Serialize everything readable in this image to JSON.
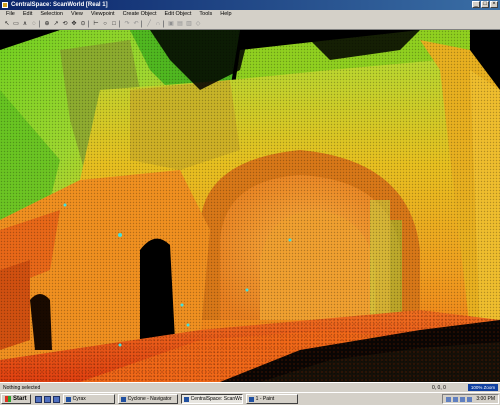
{
  "window": {
    "title": "CentralSpace: ScanWorld [Real 1]"
  },
  "menu": [
    "File",
    "Edit",
    "Selection",
    "View",
    "Viewpoint",
    "Create Object",
    "Edit Object",
    "Tools",
    "Help"
  ],
  "toolbar": {
    "tools": [
      {
        "name": "select-icon",
        "glyph": "↖"
      },
      {
        "name": "fence-icon",
        "glyph": "▭"
      },
      {
        "name": "polyline-icon",
        "glyph": "∧"
      },
      {
        "name": "lasso-icon",
        "glyph": "◌"
      },
      {
        "name": "sep"
      },
      {
        "name": "seek-icon",
        "glyph": "⊕"
      },
      {
        "name": "pick-icon",
        "glyph": "↗"
      },
      {
        "name": "rotate-icon",
        "glyph": "⟲"
      },
      {
        "name": "pan-icon",
        "glyph": "✥"
      },
      {
        "name": "zoom-icon",
        "glyph": "⊙"
      },
      {
        "name": "sep"
      },
      {
        "name": "measure-icon",
        "glyph": "⊢"
      },
      {
        "name": "circle-icon",
        "glyph": "○"
      },
      {
        "name": "box-icon",
        "glyph": "□"
      },
      {
        "name": "sep"
      },
      {
        "name": "redo-icon",
        "glyph": "↷",
        "dim": true
      },
      {
        "name": "undo-icon",
        "glyph": "↶",
        "dim": true
      },
      {
        "name": "sep"
      },
      {
        "name": "line-icon",
        "glyph": "╱",
        "dim": true
      },
      {
        "name": "curve-icon",
        "glyph": "∩",
        "dim": true
      },
      {
        "name": "sep"
      },
      {
        "name": "front-view-icon",
        "glyph": "▣",
        "dim": true
      },
      {
        "name": "side-view-icon",
        "glyph": "▤",
        "dim": true
      },
      {
        "name": "top-view-icon",
        "glyph": "▥",
        "dim": true
      },
      {
        "name": "iso-view-icon",
        "glyph": "◇",
        "dim": true
      }
    ]
  },
  "status": {
    "message": "Nothing selected",
    "coords": "0, 0, 0",
    "zoom": "100% Zoom"
  },
  "taskbar": {
    "start": "Start",
    "tasks": [
      {
        "label": "Cyrax",
        "active": false,
        "width": 52
      },
      {
        "label": "Cyclone - Navigator",
        "active": false,
        "width": 60
      },
      {
        "label": "CentralSpace: ScanWo...",
        "active": true,
        "width": 62
      },
      {
        "label": "1 - Paint",
        "active": false,
        "width": 52
      }
    ],
    "clock": "3:00 PM"
  },
  "colors": {
    "titlebar": "#0a246a",
    "chrome": "#d4d0c8",
    "viewport": "#000000"
  }
}
